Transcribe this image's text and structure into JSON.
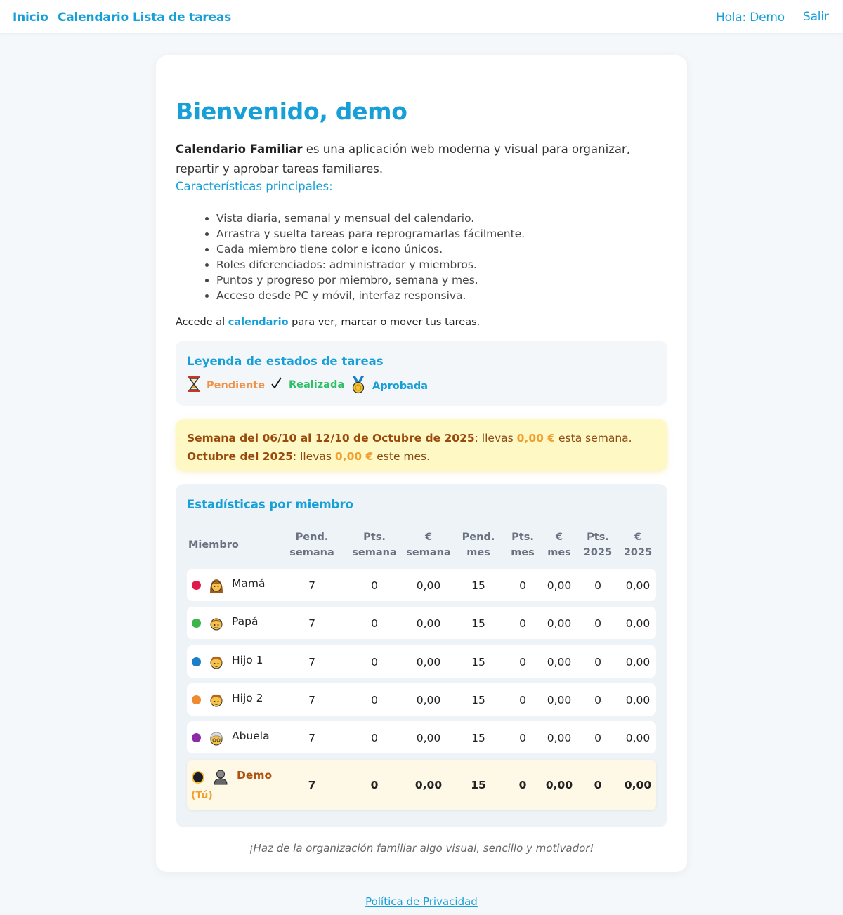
{
  "nav": {
    "home": "Inicio",
    "calendar": "Calendario",
    "tasks": "Lista de tareas",
    "greeting": "Hola: Demo",
    "logout": "Salir"
  },
  "welcome_title": "Bienvenido, demo",
  "intro": {
    "app_name": "Calendario Familiar",
    "text": " es una aplicación web moderna y visual para organizar, repartir y aprobar tareas familiares."
  },
  "features_title": "Características principales:",
  "features": [
    "Vista diaria, semanal y mensual del calendario.",
    "Arrastra y suelta tareas para reprogramarlas fácilmente.",
    "Cada miembro tiene color e icono únicos.",
    "Roles diferenciados: administrador y miembros.",
    "Puntos y progreso por miembro, semana y mes.",
    "Acceso desde PC y móvil, interfaz responsiva."
  ],
  "access": {
    "before": "Accede al ",
    "link": "calendario",
    "after": " para ver, marcar o mover tus tareas."
  },
  "legend": {
    "title": "Leyenda de estados de tareas",
    "pending": "Pendiente",
    "done": "Realizada",
    "approved": "Aprobada",
    "pending_icon": "hourglass-icon",
    "done_icon": "checkmark-icon",
    "approved_icon": "medal-icon"
  },
  "summary": {
    "week_label": "Semana del 06/10 al 12/10 de Octubre de 2025",
    "week_text_a": ": llevas ",
    "week_amount": "0,00 €",
    "week_text_b": " esta semana.",
    "month_label": "Octubre del 2025",
    "month_text_a": ": llevas ",
    "month_amount": "0,00 €",
    "month_text_b": " este mes."
  },
  "stats": {
    "title": "Estadísticas por miembro",
    "headers": {
      "member": "Miembro",
      "pend_week_1": "Pend.",
      "pend_week_2": "semana",
      "pts_week_1": "Pts.",
      "pts_week_2": "semana",
      "eur_week_1": "€",
      "eur_week_2": "semana",
      "pend_month_1": "Pend.",
      "pend_month_2": "mes",
      "pts_month_1": "Pts.",
      "pts_month_2": "mes",
      "eur_month_1": "€",
      "eur_month_2": "mes",
      "pts_year_1": "Pts.",
      "pts_year_2": "2025",
      "eur_year_1": "€",
      "eur_year_2": "2025"
    },
    "members": [
      {
        "name": "Mamá",
        "color": "#e0194a",
        "avatar": "woman-emoji",
        "pend_w": "7",
        "pts_w": "0",
        "eur_w": "0,00",
        "pend_m": "15",
        "pts_m": "0",
        "eur_m": "0,00",
        "pts_y": "0",
        "eur_y": "0,00"
      },
      {
        "name": "Papá",
        "color": "#3cb54a",
        "avatar": "man-emoji",
        "pend_w": "7",
        "pts_w": "0",
        "eur_w": "0,00",
        "pend_m": "15",
        "pts_m": "0",
        "eur_m": "0,00",
        "pts_y": "0",
        "eur_y": "0,00"
      },
      {
        "name": "Hijo 1",
        "color": "#1a7fc8",
        "avatar": "boy-emoji",
        "pend_w": "7",
        "pts_w": "0",
        "eur_w": "0,00",
        "pend_m": "15",
        "pts_m": "0",
        "eur_m": "0,00",
        "pts_y": "0",
        "eur_y": "0,00"
      },
      {
        "name": "Hijo 2",
        "color": "#f08a30",
        "avatar": "boy-emoji",
        "pend_w": "7",
        "pts_w": "0",
        "eur_w": "0,00",
        "pend_m": "15",
        "pts_m": "0",
        "eur_m": "0,00",
        "pts_y": "0",
        "eur_y": "0,00"
      },
      {
        "name": "Abuela",
        "color": "#8e2aa8",
        "avatar": "old-woman-emoji",
        "pend_w": "7",
        "pts_w": "0",
        "eur_w": "0,00",
        "pend_m": "15",
        "pts_m": "0",
        "eur_m": "0,00",
        "pts_y": "0",
        "eur_y": "0,00"
      }
    ],
    "me": {
      "name": "Demo",
      "tag": "(Tú)",
      "color": "#1a1a2e",
      "avatar": "person-emoji",
      "pend_w": "7",
      "pts_w": "0",
      "eur_w": "0,00",
      "pend_m": "15",
      "pts_m": "0",
      "eur_m": "0,00",
      "pts_y": "0",
      "eur_y": "0,00"
    }
  },
  "footnote": "¡Haz de la organización familiar algo visual, sencillo y motivador!",
  "privacy": "Política de Privacidad",
  "colors": {
    "accent": "#17a0d8",
    "pending": "#f0934a",
    "done": "#2fbf6a"
  }
}
